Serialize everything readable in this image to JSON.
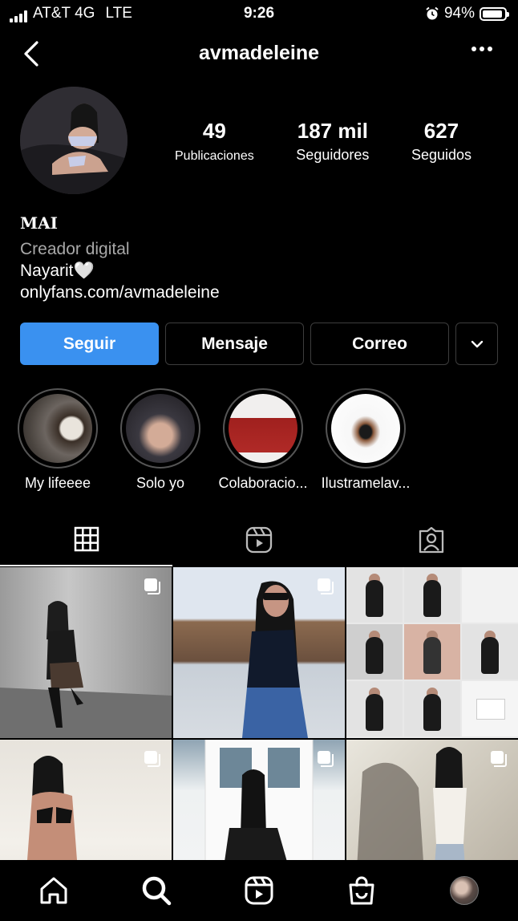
{
  "status_bar": {
    "carrier": "AT&T 4G",
    "network": "LTE",
    "time": "9:26",
    "battery_percent": "94%",
    "battery_level": 0.94,
    "alarm_icon": "alarm-clock-icon"
  },
  "header": {
    "username": "avmadeleine",
    "back_icon": "chevron-left-icon",
    "more_icon": "ellipsis-icon"
  },
  "profile": {
    "stats": [
      {
        "value": "49",
        "label": "Publicaciones"
      },
      {
        "value": "187 mil",
        "label": "Seguidores"
      },
      {
        "value": "627",
        "label": "Seguidos"
      }
    ],
    "name": "MAI",
    "category": "Creador digital",
    "bio": "Nayarit🤍",
    "link": "onlyfans.com/avmadeleine"
  },
  "actions": {
    "follow": "Seguir",
    "message": "Mensaje",
    "email": "Correo",
    "more_icon": "chevron-down-icon"
  },
  "highlights": [
    {
      "label": "My lifeeee"
    },
    {
      "label": "Solo yo"
    },
    {
      "label": "Colaboracio..."
    },
    {
      "label": "Ilustramelav..."
    }
  ],
  "tabs": [
    {
      "icon": "grid-icon",
      "active": true
    },
    {
      "icon": "reels-icon",
      "active": false
    },
    {
      "icon": "tagged-icon",
      "active": false
    }
  ],
  "bottom_nav": [
    {
      "icon": "home-icon"
    },
    {
      "icon": "search-icon"
    },
    {
      "icon": "reels-icon"
    },
    {
      "icon": "shop-icon"
    },
    {
      "icon": "profile-avatar"
    }
  ],
  "colors": {
    "background": "#000000",
    "follow_button": "#3a91f0",
    "secondary_text": "#a8a8a8",
    "border": "#3d3d3d"
  }
}
